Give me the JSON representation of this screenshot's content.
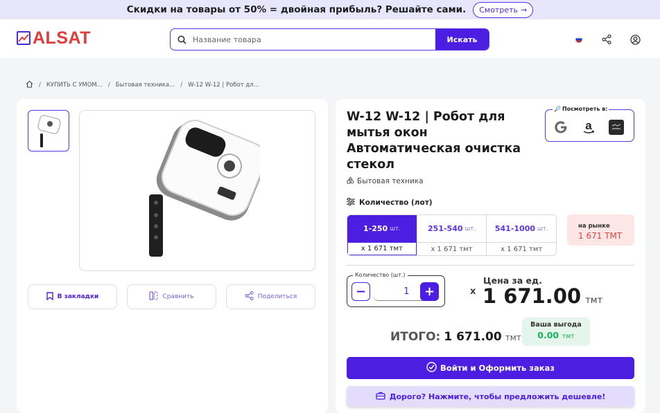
{
  "promo": {
    "text": "Скидки на товары от 50% = двойная прибыль? Решайте сами.",
    "button_label": "Смотреть"
  },
  "header": {
    "logo_text": "ALSAT",
    "search_placeholder": "Название товара",
    "search_button": "Искать",
    "icons": [
      "flag-icon",
      "share-icon",
      "user-icon"
    ]
  },
  "breadcrumb": {
    "items": [
      "КУПИТЬ С УМОМ...",
      "Бытовая техника...",
      "W-12 W-12 | Робот дл..."
    ]
  },
  "gallery": {
    "bookmark_label": "В закладки",
    "compare_label": "Сравнить",
    "share_label": "Поделиться"
  },
  "product": {
    "title": "W-12 W-12 | Робот для мытья окон Автоматическая очистка стекол",
    "category": "Бытовая техника",
    "look_label": "Посмотреть в:",
    "look_icons": [
      "google-icon",
      "amazon-icon",
      "marketplace-icon"
    ]
  },
  "quantity": {
    "heading": "Количество (лот)",
    "unit": "шт.",
    "tiers": [
      {
        "range": "1-250",
        "price": "x 1 671 тмт",
        "active": true
      },
      {
        "range": "251-540",
        "price": "x 1 671 тмт",
        "active": false
      },
      {
        "range": "541-1000",
        "price": "x 1 671 тмт",
        "active": false
      }
    ],
    "market_label": "на рынке",
    "market_value": "1 671 ТМТ"
  },
  "stepper": {
    "label": "Количество (шт.)",
    "value": "1",
    "minus": "−",
    "plus": "+"
  },
  "price": {
    "times": "x",
    "unit_label": "Цена за ед.",
    "unit_value": "1 671.00",
    "currency": "тмт"
  },
  "total": {
    "label": "ИТОГО:",
    "value": "1 671.00",
    "currency": "тмт",
    "benefit_label": "Ваша выгода",
    "benefit_value": "0.00",
    "benefit_currency": "тмт"
  },
  "actions": {
    "order_label": "Войти и Оформить заказ",
    "cheaper_label": "Дорого? Нажмите, чтобы предложить дешевле!"
  },
  "colors": {
    "accent": "#4b1ee2",
    "logo": "#e23b3b",
    "benefit": "#17b25a",
    "market": "#e0463e"
  }
}
